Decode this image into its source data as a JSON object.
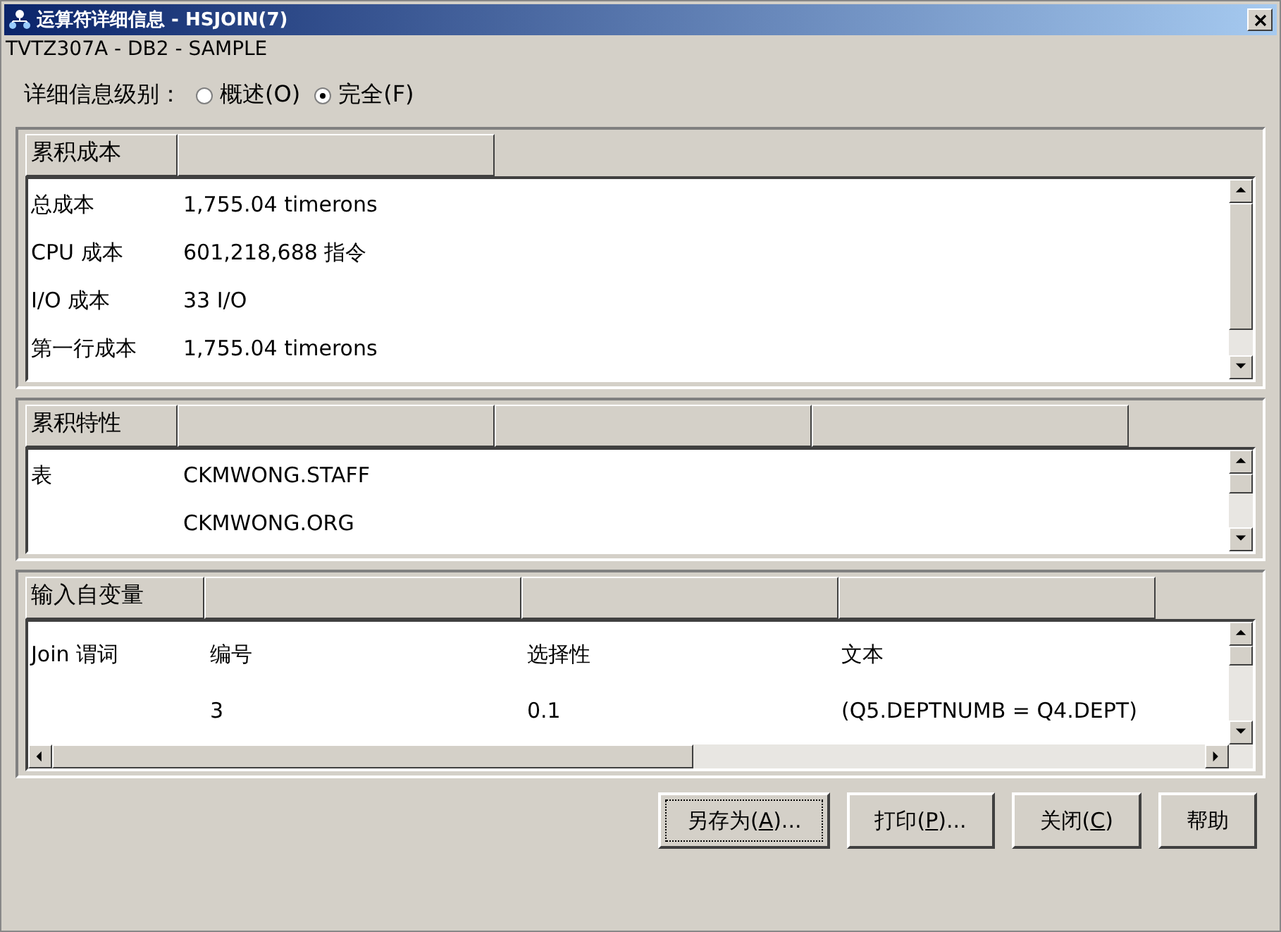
{
  "window": {
    "title": "运算符详细信息 - HSJOIN(7)"
  },
  "subtitle": "TVTZ307A - DB2 - SAMPLE",
  "detail_level": {
    "label": "详细信息级别：",
    "options": [
      {
        "label": "概述(O)",
        "selected": false
      },
      {
        "label": "完全(F)",
        "selected": true
      }
    ]
  },
  "panels": [
    {
      "kind": "two-column",
      "columns": [
        {
          "kind": "label",
          "label": "累积成本"
        },
        {
          "kind": "blank"
        }
      ],
      "rows": [
        {
          "cells": [
            "总成本",
            "1,755.04 timerons"
          ]
        },
        {
          "cells": [
            "CPU 成本",
            "601,218,688 指令"
          ]
        },
        {
          "cells": [
            "I/O 成本",
            "33 I/O"
          ]
        },
        {
          "cells": [
            "第一行成本",
            "1,755.04 timerons"
          ]
        }
      ]
    },
    {
      "kind": "two-column",
      "columns": [
        {
          "kind": "label",
          "label": "累积特性"
        },
        {
          "kind": "blank"
        },
        {
          "kind": "blank"
        },
        {
          "kind": "blank"
        }
      ],
      "rows": [
        {
          "cells": [
            "表",
            "CKMWONG.STAFF"
          ]
        },
        {
          "cells": [
            null,
            "CKMWONG.ORG"
          ]
        }
      ]
    },
    {
      "kind": "four-column",
      "columns": [
        {
          "kind": "label",
          "label": "输入自变量"
        },
        {
          "kind": "blank"
        },
        {
          "kind": "blank"
        },
        {
          "kind": "blank"
        }
      ],
      "horizontal_scrollbar": true,
      "rows": [
        {
          "cells": [
            "Join 谓词",
            "编号",
            "选择性",
            "文本"
          ]
        },
        {
          "cells": [
            null,
            "3",
            "0.1",
            "(Q5.DEPTNUMB = Q4.DEPT)"
          ]
        }
      ]
    }
  ],
  "buttons": [
    {
      "parts": [
        "另存为(",
        "A",
        ")..."
      ],
      "focused": true
    },
    {
      "parts": [
        "打印(",
        "P",
        ")..."
      ],
      "focused": false
    },
    {
      "parts": [
        "关闭(",
        "C",
        ")"
      ],
      "focused": false
    },
    {
      "parts": [
        "帮助"
      ],
      "focused": false
    }
  ]
}
